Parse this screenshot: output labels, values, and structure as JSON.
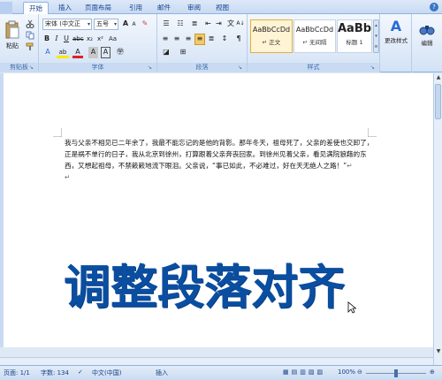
{
  "tabs": [
    "开始",
    "插入",
    "页面布局",
    "引用",
    "邮件",
    "审阅",
    "视图"
  ],
  "ribbon": {
    "clipboard": {
      "label": "剪贴板",
      "paste": "粘贴"
    },
    "font": {
      "label": "字体",
      "font_name": "宋体 (中文正",
      "font_size": "五号"
    },
    "paragraph": {
      "label": "段落"
    },
    "styles": {
      "label": "样式",
      "items": [
        {
          "preview": "AaBbCcDd",
          "name": "↵ 正文"
        },
        {
          "preview": "AaBbCcDd",
          "name": "↵ 无间隔"
        },
        {
          "preview": "AaBb",
          "name": "标题 1"
        }
      ],
      "change_styles": "更改样式"
    },
    "editing": {
      "label": "编辑"
    }
  },
  "document": {
    "body_text": "我与父亲不相见已二年余了，我最不能忘记的是他的背影。那年冬天，祖母死了，父亲的差使也交卸了，正是祸不单行的日子，我从北京到徐州，打算跟着父亲奔丧回家。到徐州见着父亲，看见满院狼藉的东西，又想起祖母，不禁簌簌地流下眼泪。父亲说，“事已如此，不必难过，好在天无绝人之路！”",
    "para_mark": "↵",
    "overlay_title": "调整段落对齐"
  },
  "statusbar": {
    "page": "页面: 1/1",
    "words": "字数: 134",
    "language": "中文(中国)",
    "mode": "插入",
    "zoom": "100%"
  },
  "colors": {
    "accent": "#0a4ea1",
    "ribbon": "#dfe8f5"
  }
}
